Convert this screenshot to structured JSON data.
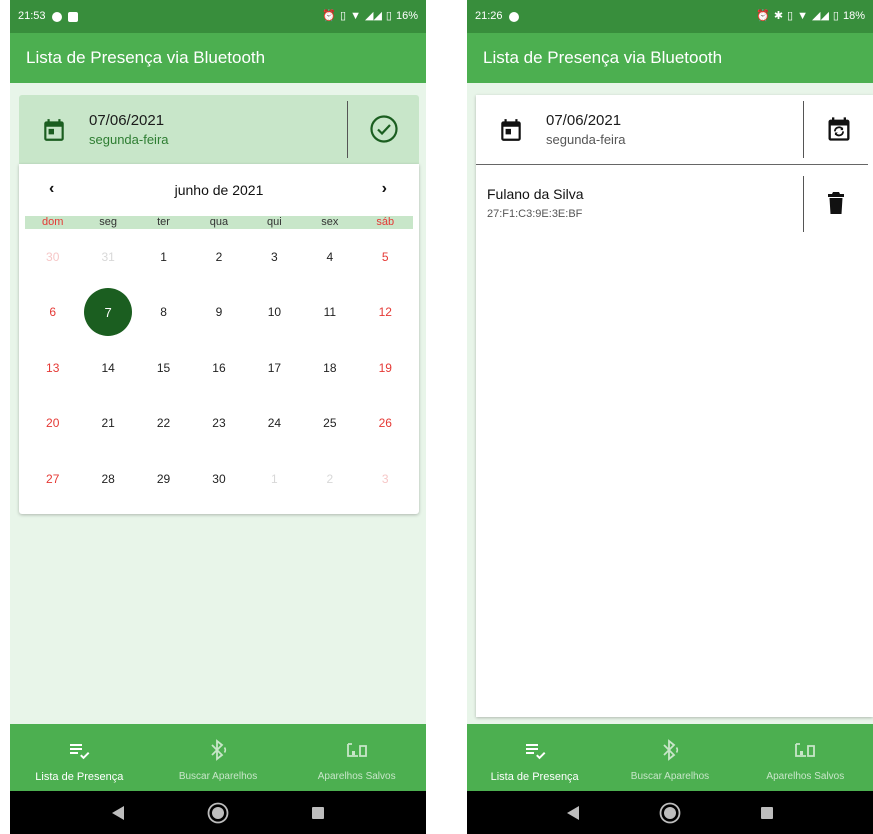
{
  "colors": {
    "status_bar": "#388e3c",
    "app_bar": "#4caf50",
    "background": "#e8f5e9",
    "header_highlight": "#c8e6c9",
    "selected_day": "#1b5e20",
    "weekend": "#e53935",
    "icon_dark_green": "#1b5e20"
  },
  "left": {
    "status": {
      "time": "21:53",
      "battery": "16%"
    },
    "app_title": "Lista de Presença via Bluetooth",
    "header": {
      "date": "07/06/2021",
      "weekday": "segunda-feira",
      "icon": "calendar-icon",
      "action_icon": "check-circle-icon"
    },
    "calendar": {
      "month_label": "junho de 2021",
      "prev": "‹",
      "next": "›",
      "weekdays": [
        "dom",
        "seg",
        "ter",
        "qua",
        "qui",
        "sex",
        "sáb"
      ],
      "weeks": [
        [
          "30",
          "31",
          "1",
          "2",
          "3",
          "4",
          "5"
        ],
        [
          "6",
          "7",
          "8",
          "9",
          "10",
          "11",
          "12"
        ],
        [
          "13",
          "14",
          "15",
          "16",
          "17",
          "18",
          "19"
        ],
        [
          "20",
          "21",
          "22",
          "23",
          "24",
          "25",
          "26"
        ],
        [
          "27",
          "28",
          "29",
          "30",
          "1",
          "2",
          "3"
        ]
      ],
      "selected_day": "7"
    },
    "nav": [
      {
        "label": "Lista de Presença",
        "icon": "playlist-check-icon",
        "active": true
      },
      {
        "label": "Buscar Aparelhos",
        "icon": "bluetooth-searching-icon",
        "active": false
      },
      {
        "label": "Aparelhos Salvos",
        "icon": "devices-icon",
        "active": false
      }
    ]
  },
  "right": {
    "status": {
      "time": "21:26",
      "battery": "18%"
    },
    "app_title": "Lista de Presença via Bluetooth",
    "header": {
      "date": "07/06/2021",
      "weekday": "segunda-feira",
      "icon": "calendar-icon",
      "action_icon": "calendar-sync-icon"
    },
    "items": [
      {
        "name": "Fulano da Silva",
        "mac": "27:F1:C3:9E:3E:BF",
        "icon": "delete-icon"
      }
    ],
    "nav": [
      {
        "label": "Lista de Presença",
        "icon": "playlist-check-icon",
        "active": true
      },
      {
        "label": "Buscar Aparelhos",
        "icon": "bluetooth-searching-icon",
        "active": false
      },
      {
        "label": "Aparelhos Salvos",
        "icon": "devices-icon",
        "active": false
      }
    ]
  }
}
